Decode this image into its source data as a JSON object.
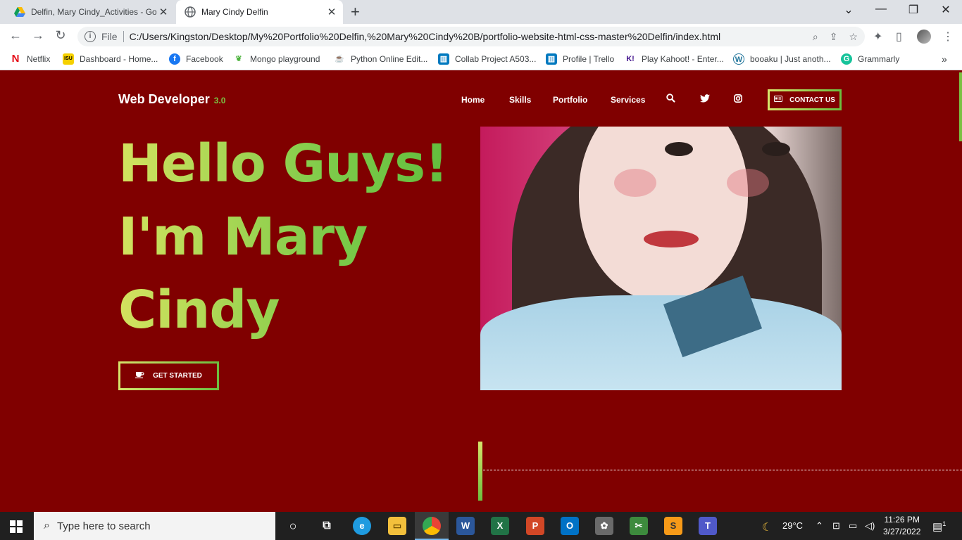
{
  "browser": {
    "tabs": [
      {
        "title": "Delfin, Mary Cindy_Activities - Go",
        "active": false
      },
      {
        "title": "Mary Cindy Delfin",
        "active": true
      }
    ],
    "new_tab": "+",
    "window_controls": {
      "tab_search": "⌄",
      "minimize": "—",
      "restore": "❐",
      "close": "✕"
    },
    "address": {
      "scheme_label": "File",
      "url": "C:/Users/Kingston/Desktop/My%20Portfolio%20Delfin,%20Mary%20Cindy%20B/portfolio-website-html-css-master%20Delfin/index.html"
    },
    "bookmarks": [
      {
        "label": "Netflix",
        "icon": "netflix-icon"
      },
      {
        "label": "Dashboard - Home...",
        "icon": "dashboard-icon"
      },
      {
        "label": "Facebook",
        "icon": "facebook-icon"
      },
      {
        "label": "Mongo playground",
        "icon": "mongo-icon"
      },
      {
        "label": "Python Online Edit...",
        "icon": "python-icon"
      },
      {
        "label": "Collab Project A503...",
        "icon": "trello-icon"
      },
      {
        "label": "Profile | Trello",
        "icon": "trello-icon"
      },
      {
        "label": "Play Kahoot! - Enter...",
        "icon": "kahoot-icon"
      },
      {
        "label": "booaku | Just anoth...",
        "icon": "wordpress-icon"
      },
      {
        "label": "Grammarly",
        "icon": "grammarly-icon"
      }
    ]
  },
  "site": {
    "logo": "Web Developer",
    "logo_version": "3.0",
    "nav": [
      "Home",
      "Skills",
      "Portfolio",
      "Services"
    ],
    "contact_label": "CONTACT US",
    "hero_lines": [
      "Hello Guys!",
      "I'm Mary",
      "Cindy"
    ],
    "cta_label": "GET STARTED"
  },
  "taskbar": {
    "search_placeholder": "Type here to search",
    "weather": "29°C",
    "time": "11:26 PM",
    "date": "3/27/2022",
    "notification_count": "1"
  },
  "colors": {
    "page_bg": "#800000",
    "accent_green": "#7ac143",
    "accent_yellow": "#d6e46b"
  }
}
